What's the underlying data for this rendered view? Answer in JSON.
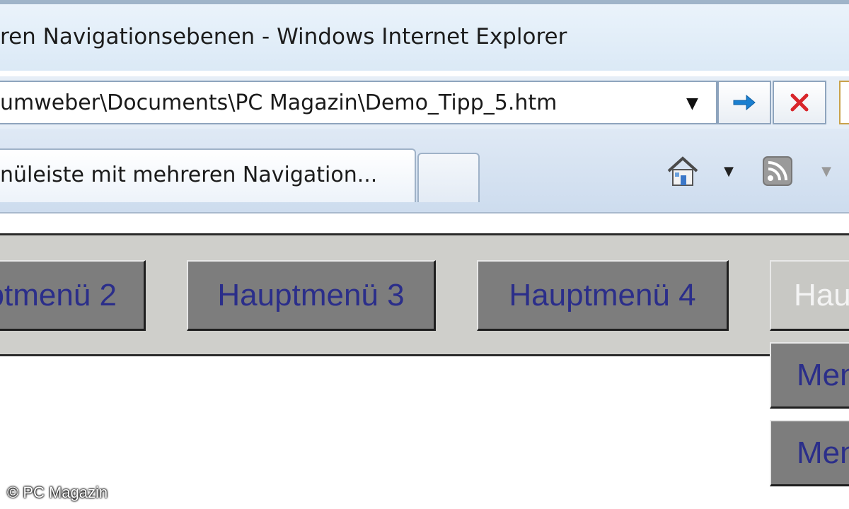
{
  "window": {
    "title": "ren Navigationsebenen - Windows Internet Explorer"
  },
  "address_bar": {
    "url": "umweber\\Documents\\PC Magazin\\Demo_Tipp_5.htm",
    "dropdown_icon": "chevron-down-icon",
    "go_icon": "arrow-right-icon",
    "stop_icon": "close-icon"
  },
  "tabs": {
    "active_label": "nüleiste mit mehreren Navigation...",
    "home_icon": "home-icon",
    "feed_icon": "rss-feed-icon"
  },
  "menu": {
    "items": [
      {
        "label": "ptmenü 2"
      },
      {
        "label": "Hauptmenü 3"
      },
      {
        "label": "Hauptmenü 4"
      },
      {
        "label": "Haupt"
      }
    ],
    "submenu": [
      {
        "label": "Menü"
      },
      {
        "label": "Menü"
      }
    ]
  },
  "watermark": "© PC Magazin",
  "colors": {
    "menu_item_bg": "#7d7d7d",
    "menu_text": "#2b2e8a",
    "menu_bar_bg": "#cfcfcb",
    "active_text": "#f4f4f4"
  }
}
